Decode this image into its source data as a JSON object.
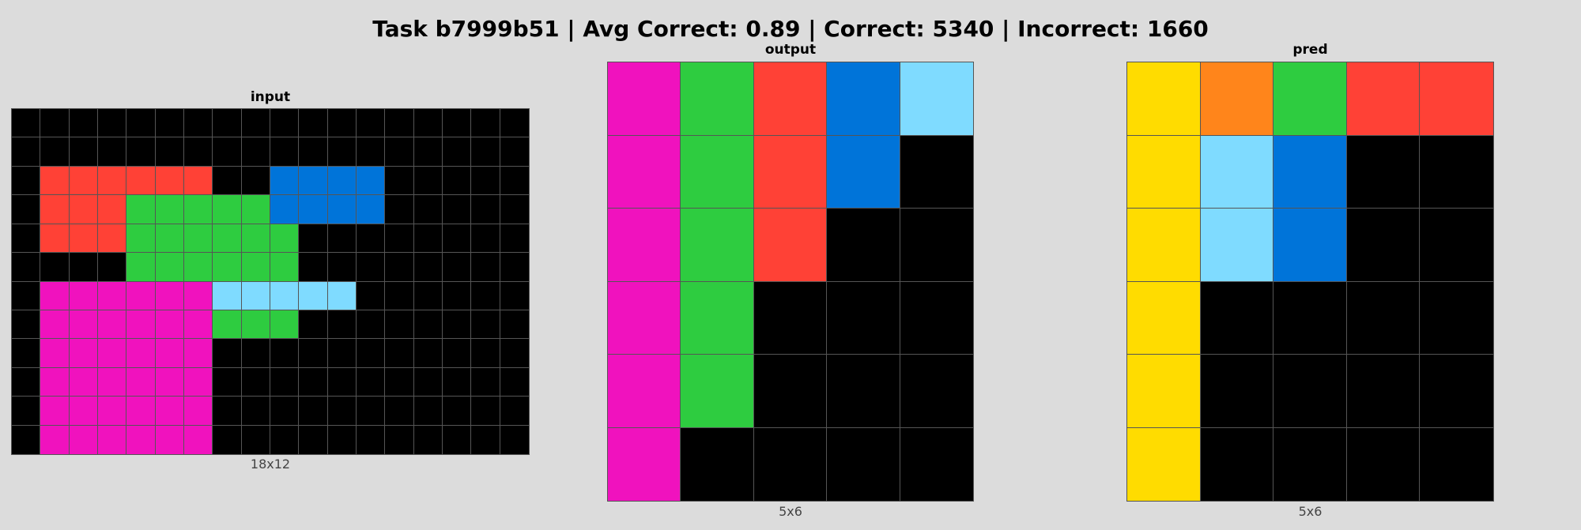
{
  "title": "Task b7999b51 | Avg Correct: 0.89 | Correct: 5340 | Incorrect: 1660",
  "palette": {
    "0": "#000000",
    "1": "#0074d9",
    "2": "#ff4136",
    "3": "#2ecc40",
    "4": "#ffdc00",
    "6": "#f012be",
    "7": "#ff851b",
    "8": "#7fdbff"
  },
  "panels": [
    {
      "title": "input",
      "dims": "18x12",
      "grid": [
        [
          0,
          0,
          0,
          0,
          0,
          0,
          0,
          0,
          0,
          0,
          0,
          0,
          0,
          0,
          0,
          0,
          0,
          0
        ],
        [
          0,
          0,
          0,
          0,
          0,
          0,
          0,
          0,
          0,
          0,
          0,
          0,
          0,
          0,
          0,
          0,
          0,
          0
        ],
        [
          0,
          2,
          2,
          2,
          2,
          2,
          2,
          0,
          0,
          1,
          1,
          1,
          1,
          0,
          0,
          0,
          0,
          0
        ],
        [
          0,
          2,
          2,
          2,
          3,
          3,
          3,
          3,
          3,
          1,
          1,
          1,
          1,
          0,
          0,
          0,
          0,
          0
        ],
        [
          0,
          2,
          2,
          2,
          3,
          3,
          3,
          3,
          3,
          3,
          0,
          0,
          0,
          0,
          0,
          0,
          0,
          0
        ],
        [
          0,
          0,
          0,
          0,
          3,
          3,
          3,
          3,
          3,
          3,
          0,
          0,
          0,
          0,
          0,
          0,
          0,
          0
        ],
        [
          0,
          6,
          6,
          6,
          6,
          6,
          6,
          8,
          8,
          8,
          8,
          8,
          0,
          0,
          0,
          0,
          0,
          0
        ],
        [
          0,
          6,
          6,
          6,
          6,
          6,
          6,
          3,
          3,
          3,
          0,
          0,
          0,
          0,
          0,
          0,
          0,
          0
        ],
        [
          0,
          6,
          6,
          6,
          6,
          6,
          6,
          0,
          0,
          0,
          0,
          0,
          0,
          0,
          0,
          0,
          0,
          0
        ],
        [
          0,
          6,
          6,
          6,
          6,
          6,
          6,
          0,
          0,
          0,
          0,
          0,
          0,
          0,
          0,
          0,
          0,
          0
        ],
        [
          0,
          6,
          6,
          6,
          6,
          6,
          6,
          0,
          0,
          0,
          0,
          0,
          0,
          0,
          0,
          0,
          0,
          0
        ],
        [
          0,
          6,
          6,
          6,
          6,
          6,
          6,
          0,
          0,
          0,
          0,
          0,
          0,
          0,
          0,
          0,
          0,
          0
        ]
      ]
    },
    {
      "title": "output",
      "dims": "5x6",
      "grid": [
        [
          6,
          3,
          2,
          1,
          8
        ],
        [
          6,
          3,
          2,
          1,
          0
        ],
        [
          6,
          3,
          2,
          0,
          0
        ],
        [
          6,
          3,
          0,
          0,
          0
        ],
        [
          6,
          3,
          0,
          0,
          0
        ],
        [
          6,
          0,
          0,
          0,
          0
        ]
      ]
    },
    {
      "title": "pred",
      "dims": "5x6",
      "grid": [
        [
          4,
          7,
          3,
          2,
          2
        ],
        [
          4,
          8,
          1,
          0,
          0
        ],
        [
          4,
          8,
          1,
          0,
          0
        ],
        [
          4,
          0,
          0,
          0,
          0
        ],
        [
          4,
          0,
          0,
          0,
          0
        ],
        [
          4,
          0,
          0,
          0,
          0
        ]
      ]
    }
  ]
}
